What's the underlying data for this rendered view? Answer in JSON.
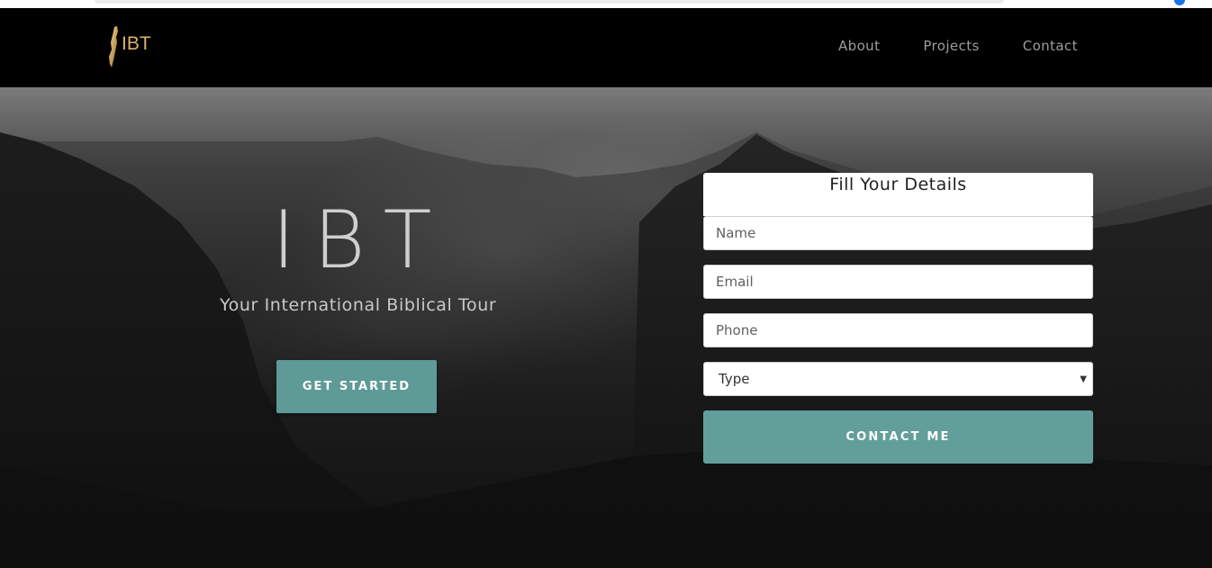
{
  "brand": {
    "logo_text": "IBT"
  },
  "nav": {
    "items": [
      {
        "label": "About"
      },
      {
        "label": "Projects"
      },
      {
        "label": "Contact"
      }
    ]
  },
  "hero": {
    "title": "IBT",
    "subtitle": "Your International Biblical Tour",
    "cta_label": "GET STARTED"
  },
  "form": {
    "title": "Fill Your Details",
    "fields": {
      "name_placeholder": "Name",
      "email_placeholder": "Email",
      "phone_placeholder": "Phone",
      "type_value": "Type"
    },
    "submit_label": "CONTACT ME"
  },
  "icons": {
    "logo": "israel-map-icon",
    "select_caret": "caret-down-icon"
  },
  "colors": {
    "accent": "#629f9a",
    "logo_gold": "#d9b46a",
    "nav_bg": "#000000",
    "nav_text": "#9d9d9d"
  }
}
